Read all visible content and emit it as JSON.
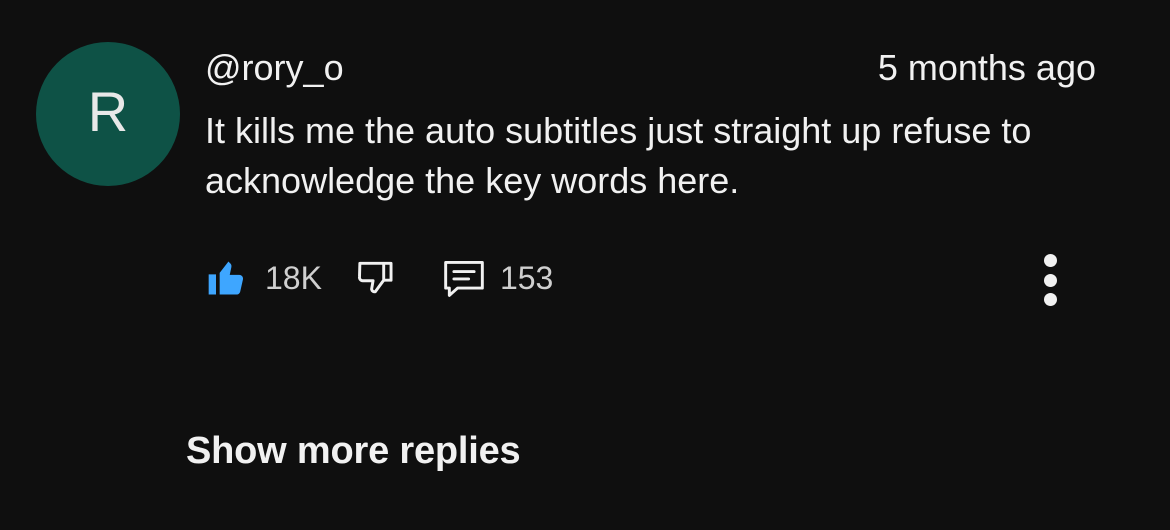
{
  "comment": {
    "avatar_letter": "R",
    "avatar_color": "#0e5246",
    "author": "@rory_o",
    "timestamp": "5 months ago",
    "text": "It kills me the auto subtitles just straight up refuse to acknowledge the key words here.",
    "like_count": "18K",
    "reply_count": "153",
    "liked": true,
    "like_color": "#3ea6ff"
  },
  "icons": {
    "like": "thumbs-up-icon",
    "dislike": "thumbs-down-icon",
    "reply": "comment-icon",
    "more": "more-vertical-icon"
  },
  "replies": {
    "show_more_label": "Show more replies"
  }
}
